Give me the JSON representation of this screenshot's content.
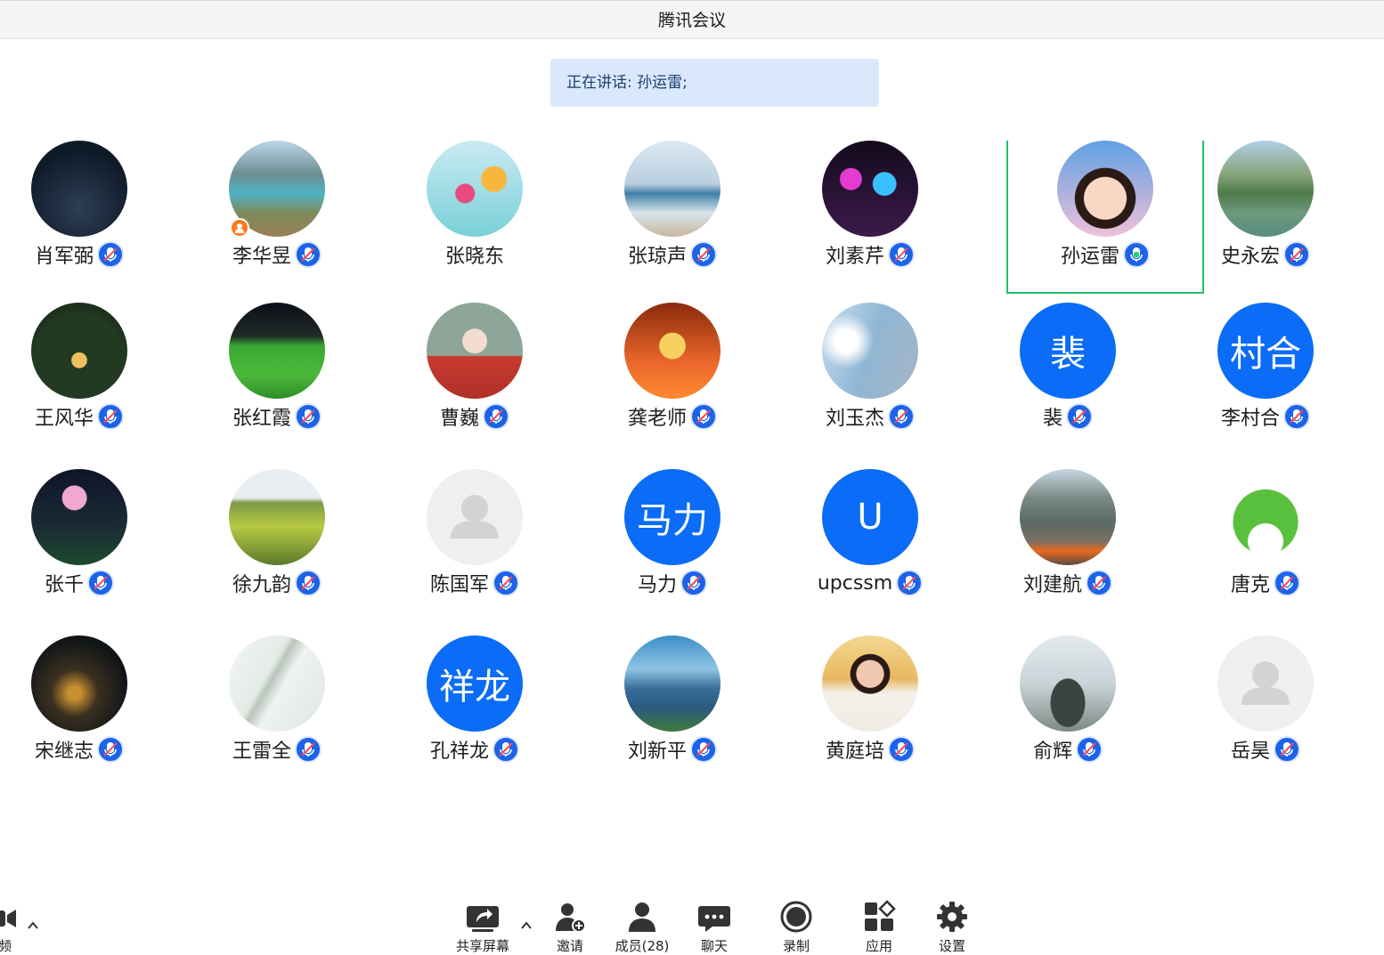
{
  "window": {
    "title": "腾讯会议"
  },
  "banner": {
    "speaking": "正在讲话: 孙运雷;"
  },
  "participants": [
    {
      "name": "肖军弼",
      "avatar": "keypad-photo",
      "mic": "muted"
    },
    {
      "name": "李华昱",
      "avatar": "lake-photo",
      "mic": "muted",
      "host": true
    },
    {
      "name": "张晓东",
      "avatar": "flowers-photo",
      "mic": "none"
    },
    {
      "name": "张琼声",
      "avatar": "beach-photo",
      "mic": "muted"
    },
    {
      "name": "刘素芹",
      "avatar": "lights-photo",
      "mic": "muted"
    },
    {
      "name": "孙运雷",
      "avatar": "child-photo",
      "mic": "speaking",
      "active": true
    },
    {
      "name": "史永宏",
      "avatar": "river-photo",
      "mic": "muted"
    },
    {
      "name": "王风华",
      "avatar": "night-garden-photo",
      "mic": "muted"
    },
    {
      "name": "张红霞",
      "avatar": "field-photo",
      "mic": "muted"
    },
    {
      "name": "曹巍",
      "avatar": "flute-girl-photo",
      "mic": "muted"
    },
    {
      "name": "龚老师",
      "avatar": "trophy-photo",
      "mic": "muted"
    },
    {
      "name": "刘玉杰",
      "avatar": "sky-photo",
      "mic": "muted"
    },
    {
      "name": "裴",
      "avatar_text": "裴",
      "mic": "muted"
    },
    {
      "name": "李村合",
      "avatar_text": "村合",
      "mic": "muted"
    },
    {
      "name": "张千",
      "avatar": "lotus-photo",
      "mic": "muted"
    },
    {
      "name": "徐九韵",
      "avatar": "rapeseed-photo",
      "mic": "muted"
    },
    {
      "name": "陈国军",
      "avatar": "default-avatar",
      "mic": "muted"
    },
    {
      "name": "马力",
      "avatar_text": "马力",
      "mic": "muted"
    },
    {
      "name": "upcssm",
      "avatar_text": "U",
      "mic": "muted"
    },
    {
      "name": "刘建航",
      "avatar": "boat-photo",
      "mic": "muted"
    },
    {
      "name": "唐克",
      "avatar": "frog-photo",
      "mic": "muted"
    },
    {
      "name": "宋继志",
      "avatar": "city-night-photo",
      "mic": "muted"
    },
    {
      "name": "王雷全",
      "avatar": "marble-photo",
      "mic": "muted"
    },
    {
      "name": "孔祥龙",
      "avatar_text": "祥龙",
      "mic": "muted"
    },
    {
      "name": "刘新平",
      "avatar": "coast-photo",
      "mic": "muted"
    },
    {
      "name": "黄庭培",
      "avatar": "kid-drawing-photo",
      "mic": "muted"
    },
    {
      "name": "俞辉",
      "avatar": "mountain-photo",
      "mic": "muted"
    },
    {
      "name": "岳昊",
      "avatar": "default-avatar",
      "mic": "muted"
    }
  ],
  "toolbar": {
    "video": "视频",
    "share": "共享屏幕",
    "invite": "邀请",
    "members": "成员(28)",
    "chat": "聊天",
    "record": "录制",
    "apps": "应用",
    "settings": "设置"
  },
  "colors": {
    "accent": "#0a6cf7",
    "active_border": "#21c06d",
    "banner_bg": "#d9e8fb"
  }
}
